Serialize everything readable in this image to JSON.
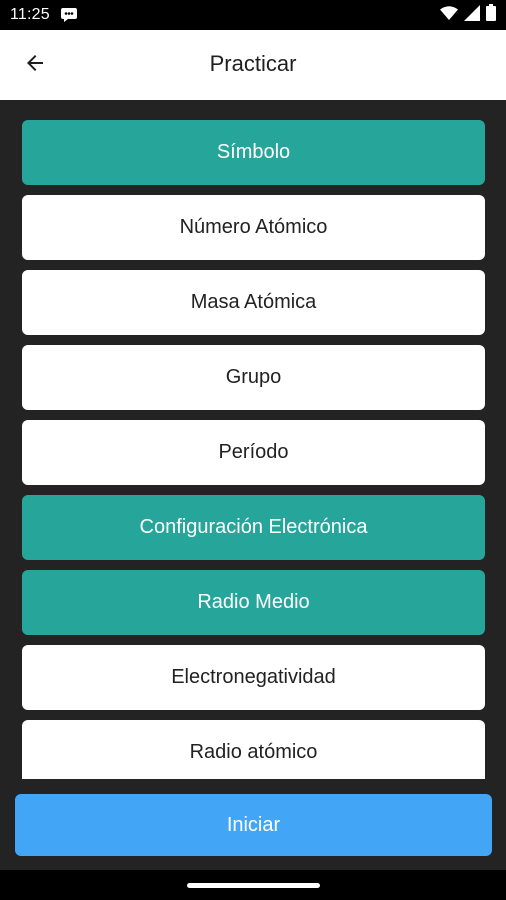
{
  "status_bar": {
    "time": "11:25",
    "notification_icon": "chat-bubble-icon",
    "right_icons": [
      "wifi-icon",
      "signal-icon",
      "battery-icon"
    ]
  },
  "app_bar": {
    "title": "Practicar",
    "back_icon": "arrow-left-icon"
  },
  "options": [
    {
      "label": "Símbolo",
      "selected": true
    },
    {
      "label": "Número Atómico",
      "selected": false
    },
    {
      "label": "Masa Atómica",
      "selected": false
    },
    {
      "label": "Grupo",
      "selected": false
    },
    {
      "label": "Período",
      "selected": false
    },
    {
      "label": "Configuración Electrónica",
      "selected": true
    },
    {
      "label": "Radio Medio",
      "selected": true
    },
    {
      "label": "Electronegatividad",
      "selected": false
    },
    {
      "label": "Radio atómico",
      "selected": false
    }
  ],
  "start_button": {
    "label": "Iniciar"
  },
  "colors": {
    "selected": "#26a69a",
    "unselected": "#ffffff",
    "start_button": "#42a5f5",
    "background": "#232323"
  }
}
